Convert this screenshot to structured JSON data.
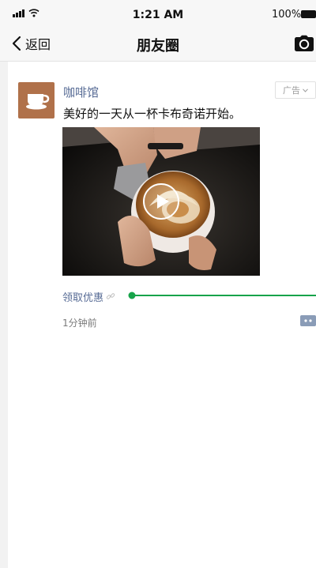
{
  "status_bar": {
    "time": "1:21 AM",
    "battery": "100%"
  },
  "nav": {
    "back_label": "返回",
    "title": "朋友圈",
    "back_icon": "chevron-left-icon",
    "camera_icon": "camera-icon"
  },
  "post": {
    "author": "咖啡馆",
    "ad_label": "广告",
    "text": "美好的一天从一杯卡布奇诺开始。",
    "coupon_link": "领取优惠",
    "timestamp": "1分钟前",
    "avatar_icon": "coffee-cup-icon",
    "media_icon": "play-icon"
  },
  "colors": {
    "link_blue": "#576b95",
    "annotation_green": "#17a34a",
    "avatar_brown": "#b0714a"
  }
}
